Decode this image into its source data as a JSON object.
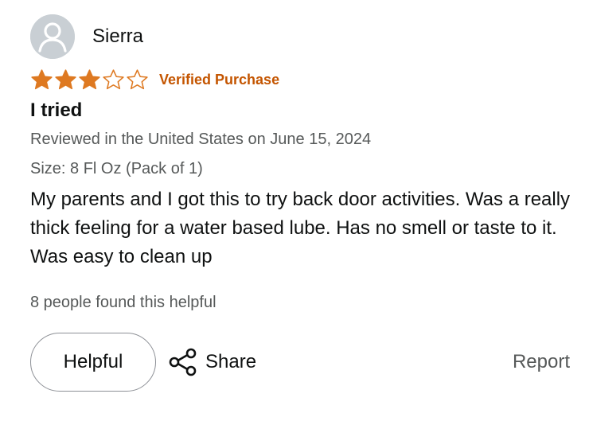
{
  "review": {
    "author": "Sierra",
    "rating": 3,
    "rating_max": 5,
    "star_color": "#de7921",
    "verified_label": "Verified Purchase",
    "verified_color": "#c45500",
    "title": "I tried",
    "date_line": "Reviewed in the United States on June 15, 2024",
    "size_line": "Size: 8 Fl Oz (Pack of 1)",
    "body": "My parents and I got this to try back door activities. Was a really thick feeling for a water based lube. Has no smell or taste to it. Was easy to clean up",
    "helpful_count_text": "8 people found this helpful"
  },
  "actions": {
    "helpful_label": "Helpful",
    "share_label": "Share",
    "report_label": "Report"
  },
  "icons": {
    "avatar": "default-user-avatar-icon",
    "star_filled": "star-filled-icon",
    "star_empty": "star-empty-icon",
    "share": "share-icon"
  }
}
